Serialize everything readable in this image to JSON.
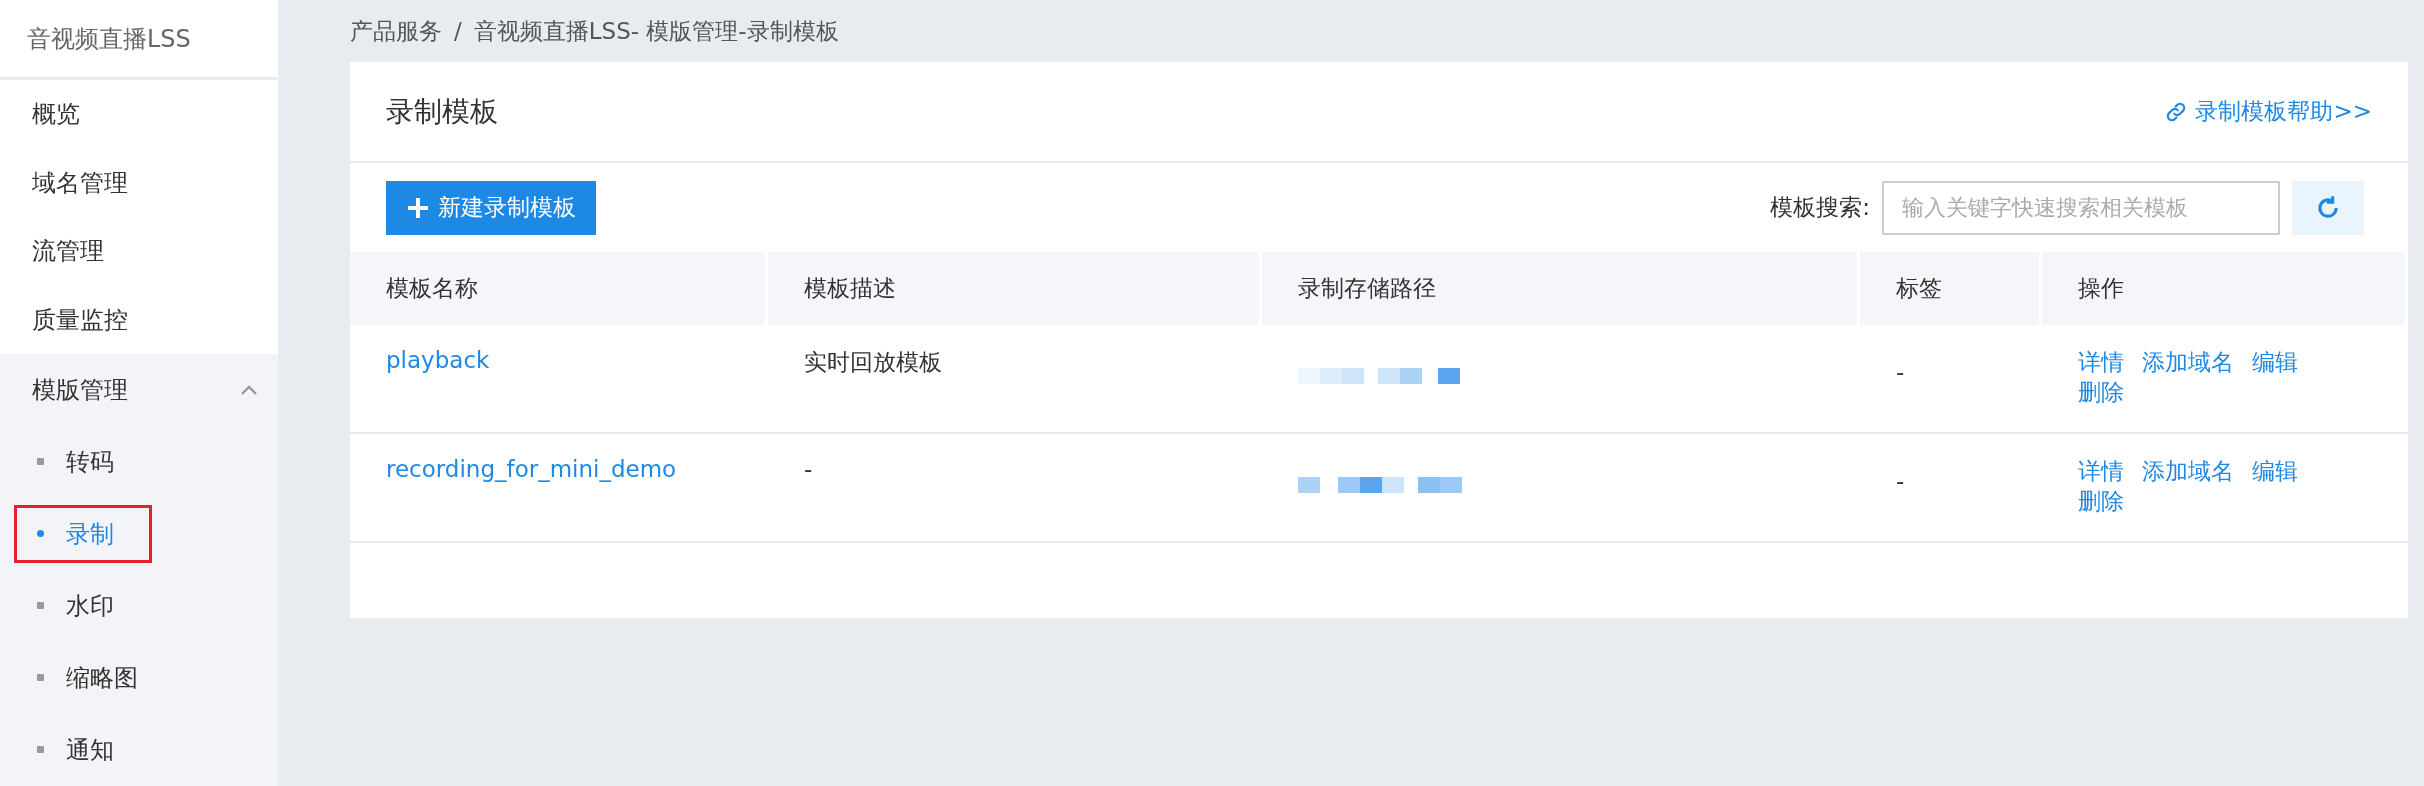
{
  "sidebar": {
    "title": "音视频直播LSS",
    "items": [
      {
        "kind": "item",
        "label": "概览",
        "selected": false
      },
      {
        "kind": "item",
        "label": "域名管理",
        "selected": false
      },
      {
        "kind": "item",
        "label": "流管理",
        "selected": false
      },
      {
        "kind": "item",
        "label": "质量监控",
        "selected": false
      },
      {
        "kind": "group",
        "label": "模版管理",
        "expanded": true,
        "children": [
          {
            "label": "转码",
            "selected": false,
            "highlighted": false
          },
          {
            "label": "录制",
            "selected": true,
            "highlighted": true
          },
          {
            "label": "水印",
            "selected": false,
            "highlighted": false
          },
          {
            "label": "缩略图",
            "selected": false,
            "highlighted": false
          },
          {
            "label": "通知",
            "selected": false,
            "highlighted": false
          }
        ]
      }
    ]
  },
  "breadcrumb": [
    "产品服务",
    "/",
    "音视频直播LSS- 模版管理-录制模板"
  ],
  "card": {
    "title": "录制模板",
    "help_link": "录制模板帮助>>",
    "new_button": "新建录制模板",
    "search_label": "模板搜索:",
    "search": {
      "placeholder": "输入关键字快速搜索相关模板"
    },
    "table": {
      "columns": [
        "模板名称",
        "模板描述",
        "录制存储路径",
        "标签",
        "操作"
      ],
      "rows": [
        {
          "name": "playback",
          "description": "实时回放模板",
          "tag": "-",
          "actions": [
            "详情",
            "添加域名",
            "编辑",
            "删除"
          ]
        },
        {
          "name": "recording_for_mini_demo",
          "description": "-",
          "tag": "-",
          "actions": [
            "详情",
            "添加域名",
            "编辑",
            "删除"
          ]
        }
      ]
    }
  }
}
